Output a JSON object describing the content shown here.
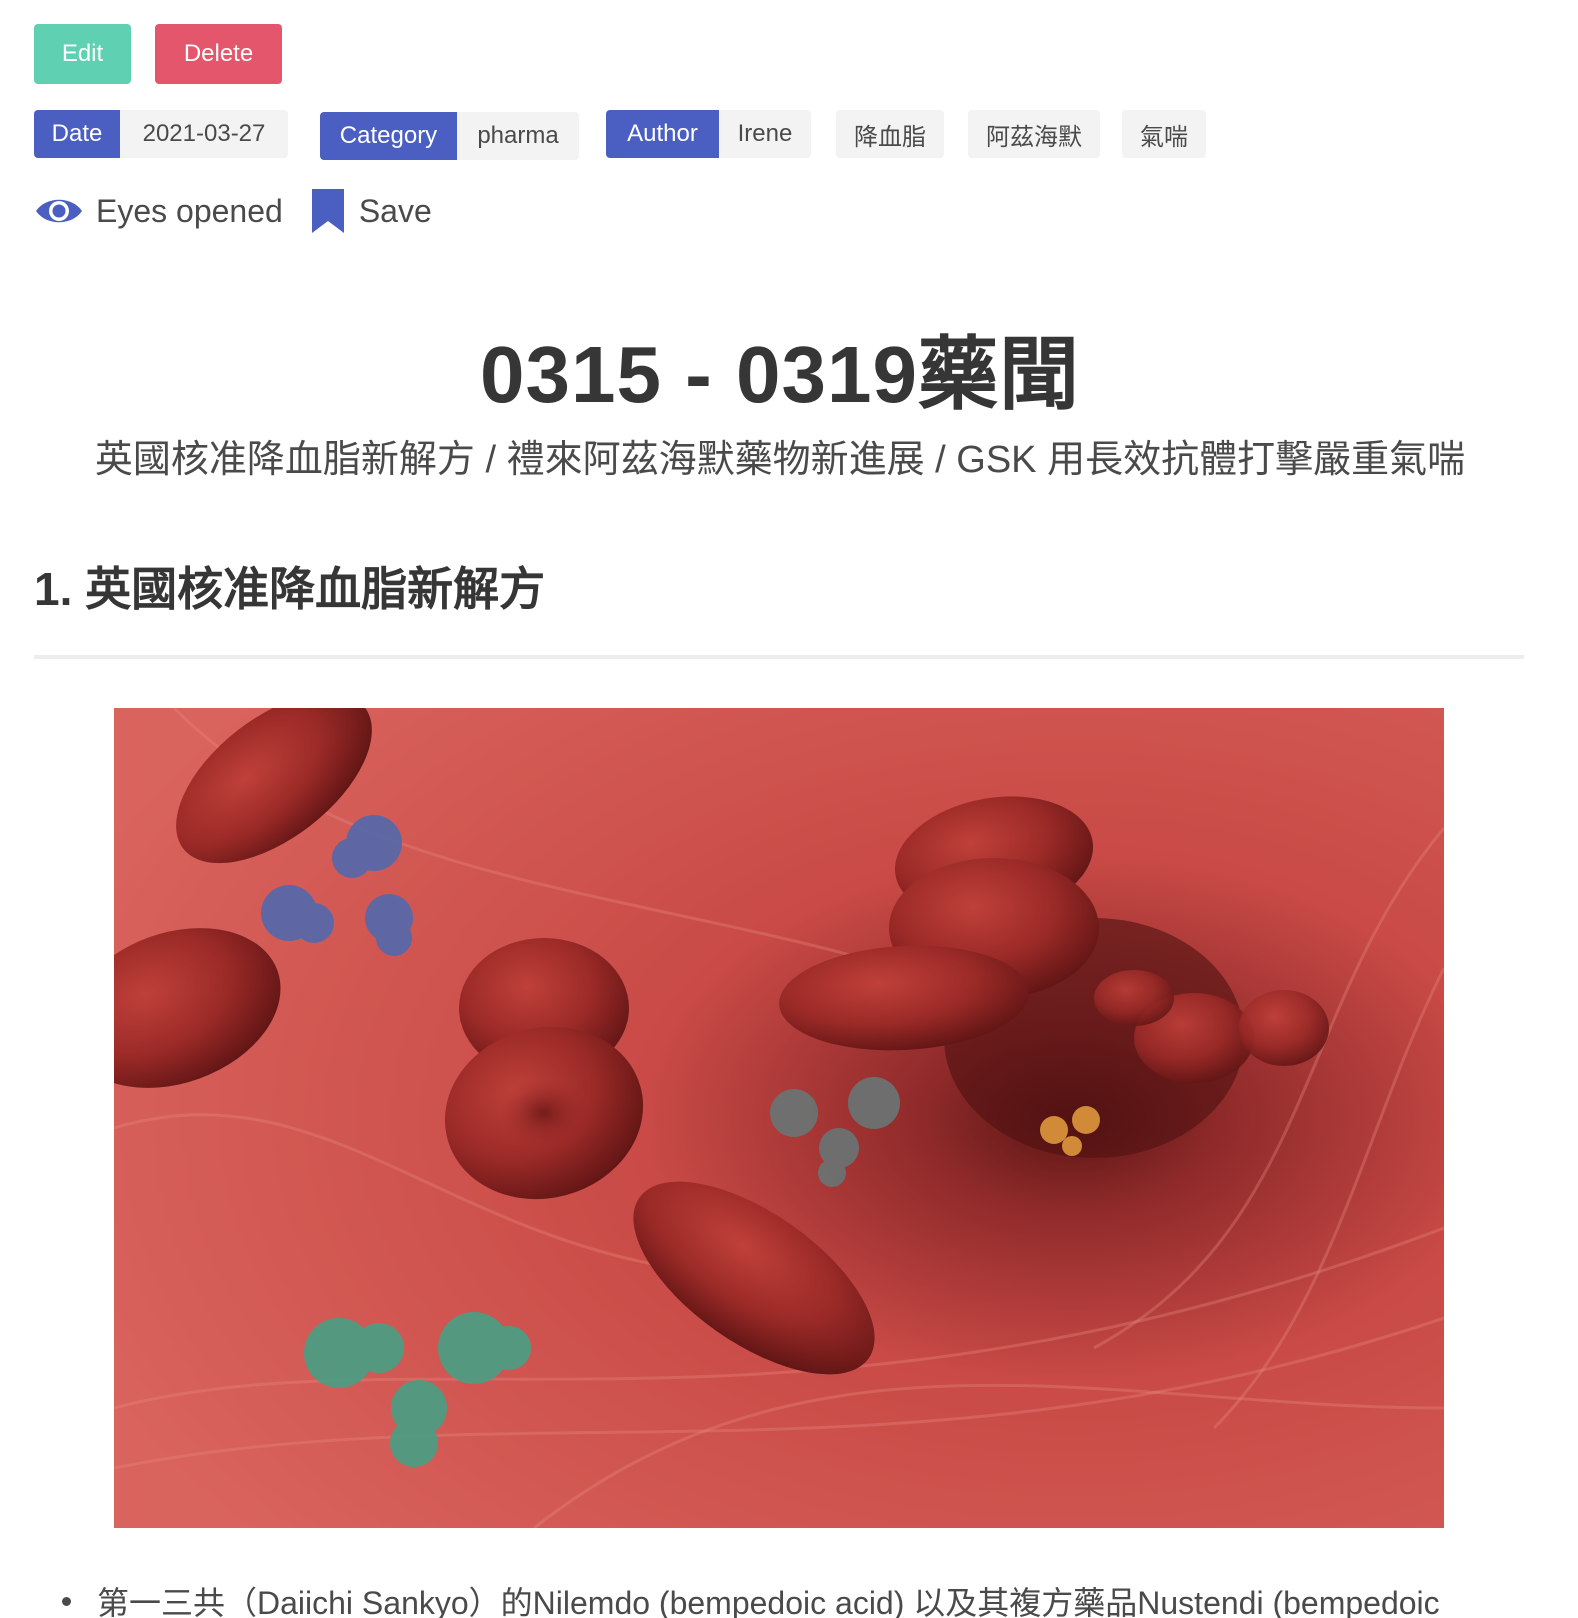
{
  "actions": {
    "edit_label": "Edit",
    "delete_label": "Delete"
  },
  "meta_tags": {
    "date_key": "Date",
    "date_value": "2021-03-27",
    "category_key": "Category",
    "category_value": "pharma",
    "author_key": "Author",
    "author_value": "Irene",
    "keywords": [
      "降血脂",
      "阿茲海默",
      "氣喘"
    ]
  },
  "stats": {
    "eyes_label": "Eyes opened",
    "save_label": "Save"
  },
  "colors": {
    "primary": "#4a5fc1",
    "edit": "#5fd0b2",
    "delete": "#e4566b",
    "tag_bg": "#f3f3f3"
  },
  "icons": {
    "eyes": "eye-icon",
    "save": "bookmark-icon"
  },
  "article": {
    "title": "0315 - 0319藥聞",
    "subtitle": "英國核准降血脂新解方 / 禮來阿茲海默藥物新進展 / GSK 用長效抗體打擊嚴重氣喘",
    "section1_heading": "1. 英國核准降血脂新解方",
    "bullet1": "第一三共（Daiichi Sankyo）的Nilemdo (bempedoic acid) 以及其複方藥品Nustendi (bempedoic"
  }
}
